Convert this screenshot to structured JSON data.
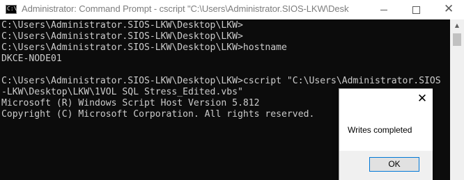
{
  "window": {
    "title": "Administrator: Command Prompt - cscript  \"C:\\Users\\Administrator.SIOS-LKW\\Desktop\\LK...",
    "icon": "cmd-icon",
    "icon_glyph": "C:\\",
    "controls": {
      "minimize": "minimize-icon",
      "maximize": "maximize-icon",
      "close": "close-icon",
      "close_glyph": "✕"
    }
  },
  "console": {
    "text_color": "#cccccc",
    "background": "#0c0c0c",
    "lines": [
      "C:\\Users\\Administrator.SIOS-LKW\\Desktop\\LKW>",
      "C:\\Users\\Administrator.SIOS-LKW\\Desktop\\LKW>",
      "C:\\Users\\Administrator.SIOS-LKW\\Desktop\\LKW>hostname",
      "DKCE-NODE01",
      "",
      "C:\\Users\\Administrator.SIOS-LKW\\Desktop\\LKW>cscript \"C:\\Users\\Administrator.SIOS",
      "-LKW\\Desktop\\LKW\\1VOL SQL Stress_Edited.vbs\"",
      "Microsoft (R) Windows Script Host Version 5.812",
      "Copyright (C) Microsoft Corporation. All rights reserved."
    ]
  },
  "scrollbar": {
    "up_arrow": "▲"
  },
  "dialog": {
    "close_glyph": "✕",
    "message": "Writes completed",
    "ok_label": "OK"
  }
}
